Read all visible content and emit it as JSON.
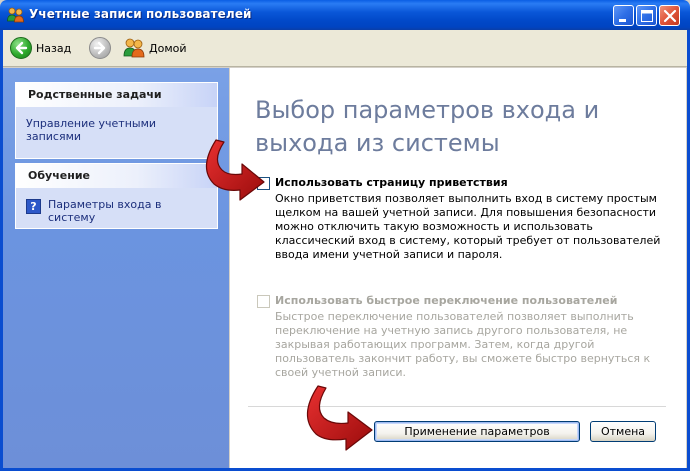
{
  "window": {
    "title": "Учетные записи пользователей"
  },
  "toolbar": {
    "back_label": "Назад",
    "home_label": "Домой"
  },
  "leftpane": {
    "related_header": "Родственные задачи",
    "related_link": "Управление учетными записями",
    "learn_header": "Обучение",
    "learn_link": "Параметры входа в систему"
  },
  "main": {
    "heading": "Выбор параметров входа и выхода из системы",
    "option1": {
      "label": "Использовать страницу приветствия",
      "description": "Окно приветствия позволяет выполнить вход в систему простым щелком на вашей учетной записи. Для повышения безопасности можно отключить такую возможность и использовать классический вход в систему, который требует от пользователей ввода имени учетной записи и пароля.",
      "checked": false
    },
    "option2": {
      "label": "Использовать быстрое переключение пользователей",
      "description": "Быстрое переключение пользователей позволяет выполнить переключение на учетную запись другого пользователя, не закрывая работающих программ. Затем, когда другой пользователь закончит работу, вы сможете быстро вернуться к своей учетной записи.",
      "checked": false,
      "disabled": true
    },
    "apply_label": "Применение параметров",
    "cancel_label": "Отмена"
  },
  "colors": {
    "titlebar": "#0148c8",
    "taskpane": "#6d8fd8",
    "heading": "#6d7c9d",
    "arrow": "#c8141a"
  }
}
